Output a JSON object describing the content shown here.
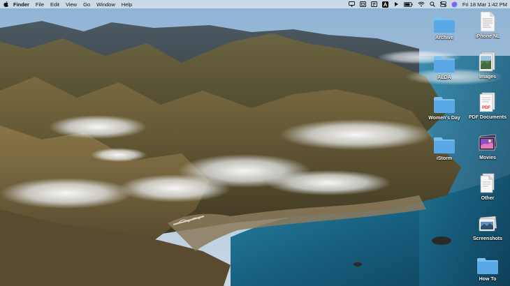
{
  "menubar": {
    "app_name": "Finder",
    "menus": [
      "File",
      "Edit",
      "View",
      "Go",
      "Window",
      "Help"
    ],
    "clock": "Fri 18 Mar  1:42 PM",
    "status_icons": [
      "screen-mirroring-icon",
      "window-icon",
      "app-store-icon",
      "font-a-icon",
      "play-icon",
      "battery-icon",
      "wifi-icon",
      "spotlight-search-icon",
      "control-center-icon",
      "siri-icon"
    ]
  },
  "desktop": {
    "icons": [
      {
        "label": "Archive",
        "kind": "folder"
      },
      {
        "label": "iPhone NL",
        "kind": "document"
      },
      {
        "label": "ALDA",
        "kind": "folder"
      },
      {
        "label": "Images",
        "kind": "image-stack"
      },
      {
        "label": "Women's Day",
        "kind": "folder"
      },
      {
        "label": "PDF Documents",
        "kind": "pdf-stack"
      },
      {
        "label": "iStorm",
        "kind": "folder"
      },
      {
        "label": "Movies",
        "kind": "movie-stack"
      },
      {
        "label": "Other",
        "kind": "document-stack"
      },
      {
        "label": "Screenshots",
        "kind": "screenshot-stack"
      },
      {
        "label": "How To",
        "kind": "folder"
      }
    ]
  },
  "colors": {
    "folder": "#5aa9e6",
    "folder_tab": "#7cc0f0",
    "menubar": "#d6e2ec",
    "ocean": "#1d6a8e"
  }
}
